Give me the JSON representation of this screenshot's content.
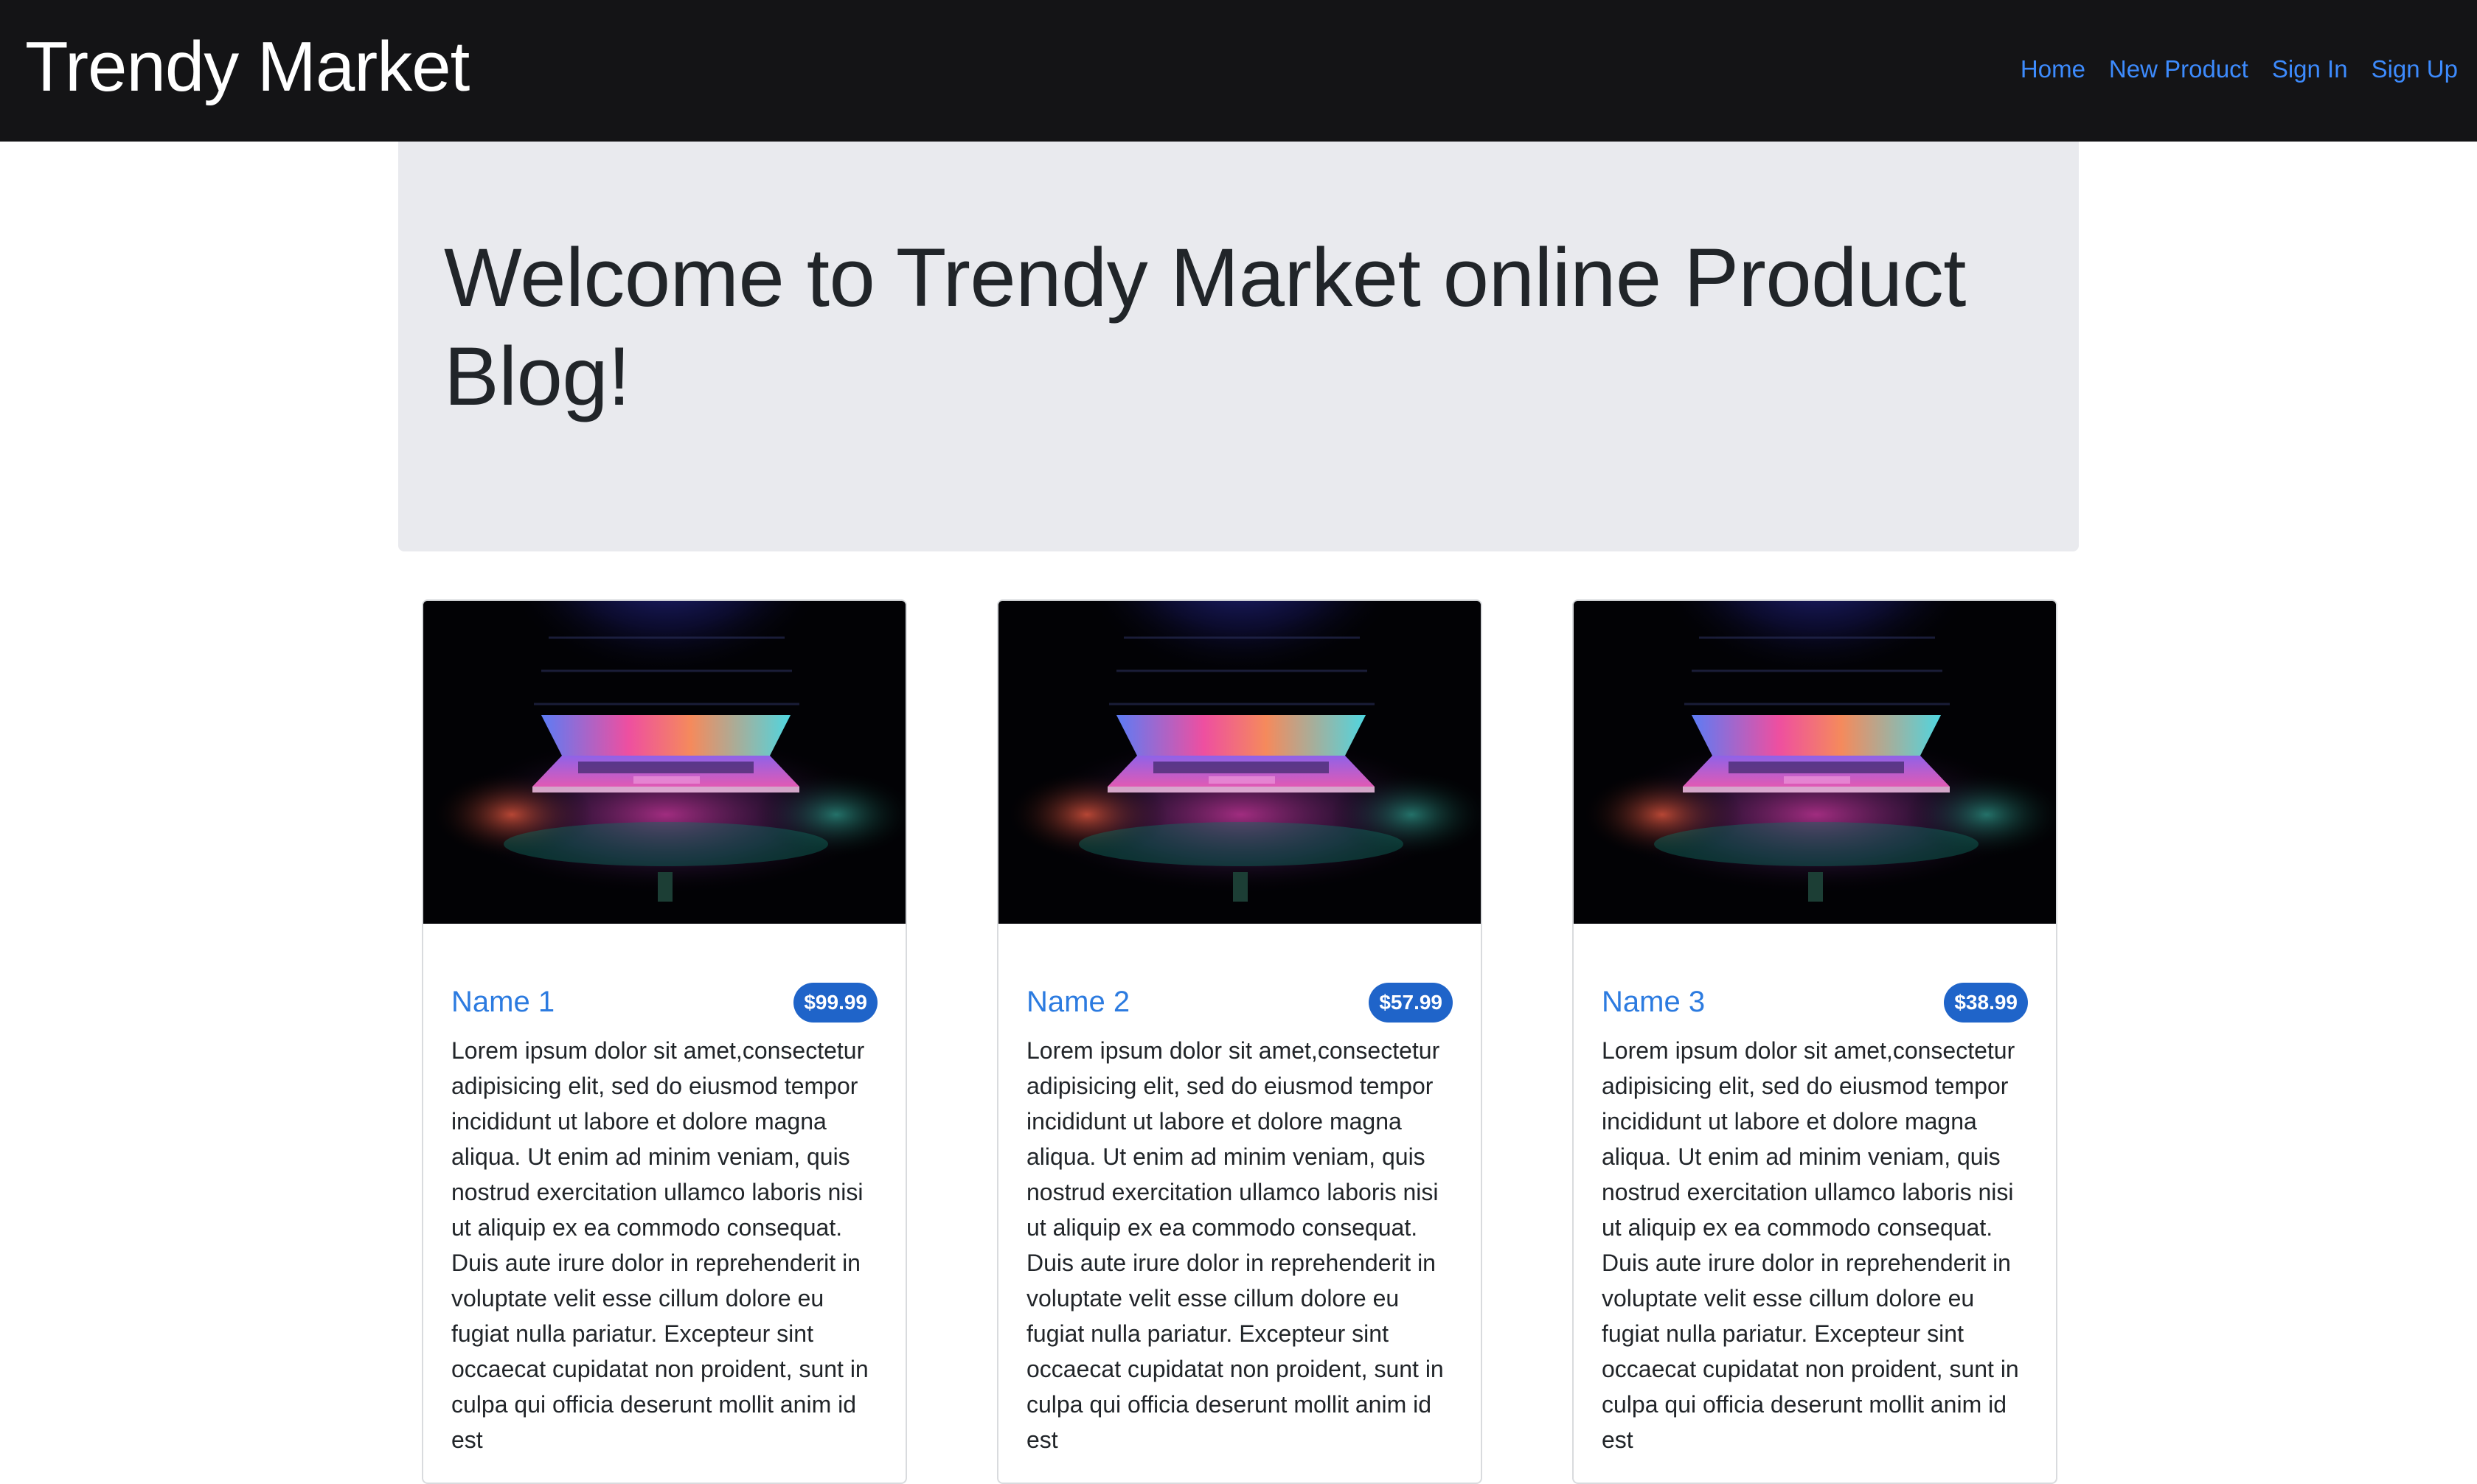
{
  "navbar": {
    "brand": "Trendy Market",
    "links": [
      "Home",
      "New Product",
      "Sign In",
      "Sign Up"
    ]
  },
  "jumbotron": {
    "title": "Welcome to Trendy Market online Product Blog!"
  },
  "products": [
    {
      "name": "Name 1",
      "price": "$99.99",
      "image": "laptop-image",
      "description": "Lorem ipsum dolor sit amet,consectetur adipisicing elit, sed do eiusmod tempor incididunt ut labore et dolore magna aliqua. Ut enim ad minim veniam, quis nostrud exercitation ullamco laboris nisi ut aliquip ex ea commodo consequat. Duis aute irure dolor in reprehenderit in voluptate velit esse cillum dolore eu fugiat nulla pariatur. Excepteur sint occaecat cupidatat non proident, sunt in culpa qui officia deserunt mollit anim id est"
    },
    {
      "name": "Name 2",
      "price": "$57.99",
      "image": "laptop-image",
      "description": "Lorem ipsum dolor sit amet,consectetur adipisicing elit, sed do eiusmod tempor incididunt ut labore et dolore magna aliqua. Ut enim ad minim veniam, quis nostrud exercitation ullamco laboris nisi ut aliquip ex ea commodo consequat. Duis aute irure dolor in reprehenderit in voluptate velit esse cillum dolore eu fugiat nulla pariatur. Excepteur sint occaecat cupidatat non proident, sunt in culpa qui officia deserunt mollit anim id est"
    },
    {
      "name": "Name 3",
      "price": "$38.99",
      "image": "laptop-image",
      "description": "Lorem ipsum dolor sit amet,consectetur adipisicing elit, sed do eiusmod tempor incididunt ut labore et dolore magna aliqua. Ut enim ad minim veniam, quis nostrud exercitation ullamco laboris nisi ut aliquip ex ea commodo consequat. Duis aute irure dolor in reprehenderit in voluptate velit esse cillum dolore eu fugiat nulla pariatur. Excepteur sint occaecat cupidatat non proident, sunt in culpa qui officia deserunt mollit anim id est"
    }
  ],
  "colors": {
    "navbar_bg": "#141416",
    "link": "#3d8bfd",
    "jumbotron_bg": "#e9eaee",
    "card_title": "#2c7be0",
    "badge_bg": "#1f64c9"
  }
}
